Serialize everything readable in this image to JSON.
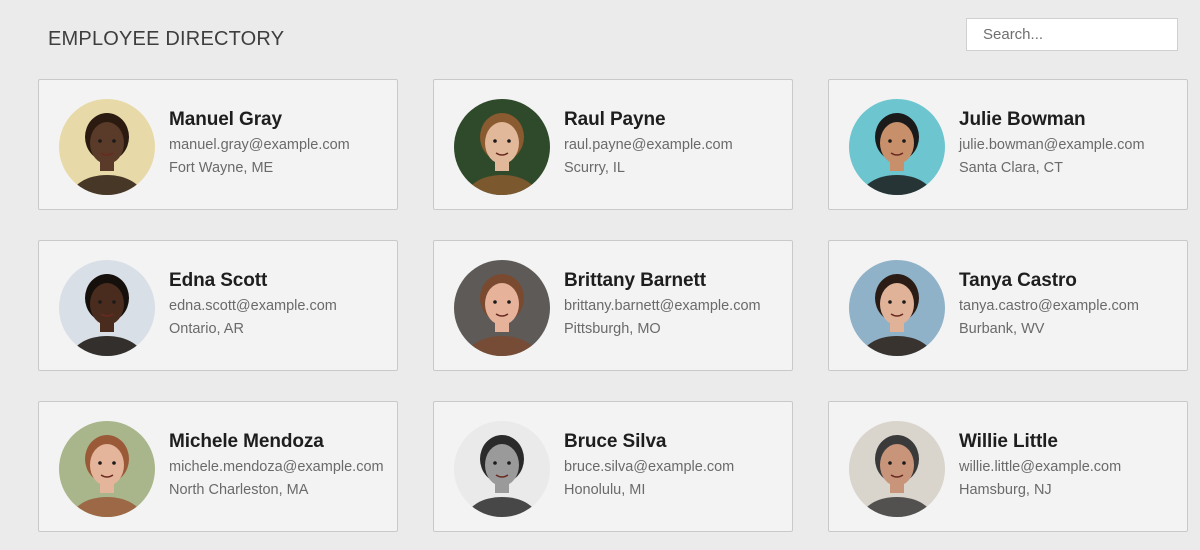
{
  "header": {
    "title": "EMPLOYEE DIRECTORY",
    "search_placeholder": "Search..."
  },
  "employees": [
    {
      "name": "Manuel Gray",
      "email": "manuel.gray@example.com",
      "location": "Fort Wayne, ME",
      "bg": "#e8d9a8",
      "skin": "#5a3a28",
      "hair": "#2a1a10"
    },
    {
      "name": "Raul Payne",
      "email": "raul.payne@example.com",
      "location": "Scurry, IL",
      "bg": "#2f4a2a",
      "skin": "#e2b89a",
      "hair": "#8a5a30"
    },
    {
      "name": "Julie Bowman",
      "email": "julie.bowman@example.com",
      "location": "Santa Clara, CT",
      "bg": "#6cc5cf",
      "skin": "#c8906a",
      "hair": "#1a1a1a"
    },
    {
      "name": "Edna Scott",
      "email": "edna.scott@example.com",
      "location": "Ontario, AR",
      "bg": "#d9dfe6",
      "skin": "#4a2c1e",
      "hair": "#15100c"
    },
    {
      "name": "Brittany Barnett",
      "email": "brittany.barnett@example.com",
      "location": "Pittsburgh, MO",
      "bg": "#5d5a58",
      "skin": "#e6b39a",
      "hair": "#7a4a30"
    },
    {
      "name": "Tanya Castro",
      "email": "tanya.castro@example.com",
      "location": "Burbank, WV",
      "bg": "#8fb2c8",
      "skin": "#e0b298",
      "hair": "#2a1c14"
    },
    {
      "name": "Michele Mendoza",
      "email": "michele.mendoza@example.com",
      "location": "North Charleston, MA",
      "bg": "#a9b58a",
      "skin": "#e4b59a",
      "hair": "#9a5a38"
    },
    {
      "name": "Bruce Silva",
      "email": "bruce.silva@example.com",
      "location": "Honolulu, MI",
      "bg": "#eaeaea",
      "skin": "#9a9a9a",
      "hair": "#2a2a2a"
    },
    {
      "name": "Willie Little",
      "email": "willie.little@example.com",
      "location": "Hamsburg, NJ",
      "bg": "#d9d4cc",
      "skin": "#c8957a",
      "hair": "#3a3a3a"
    }
  ]
}
